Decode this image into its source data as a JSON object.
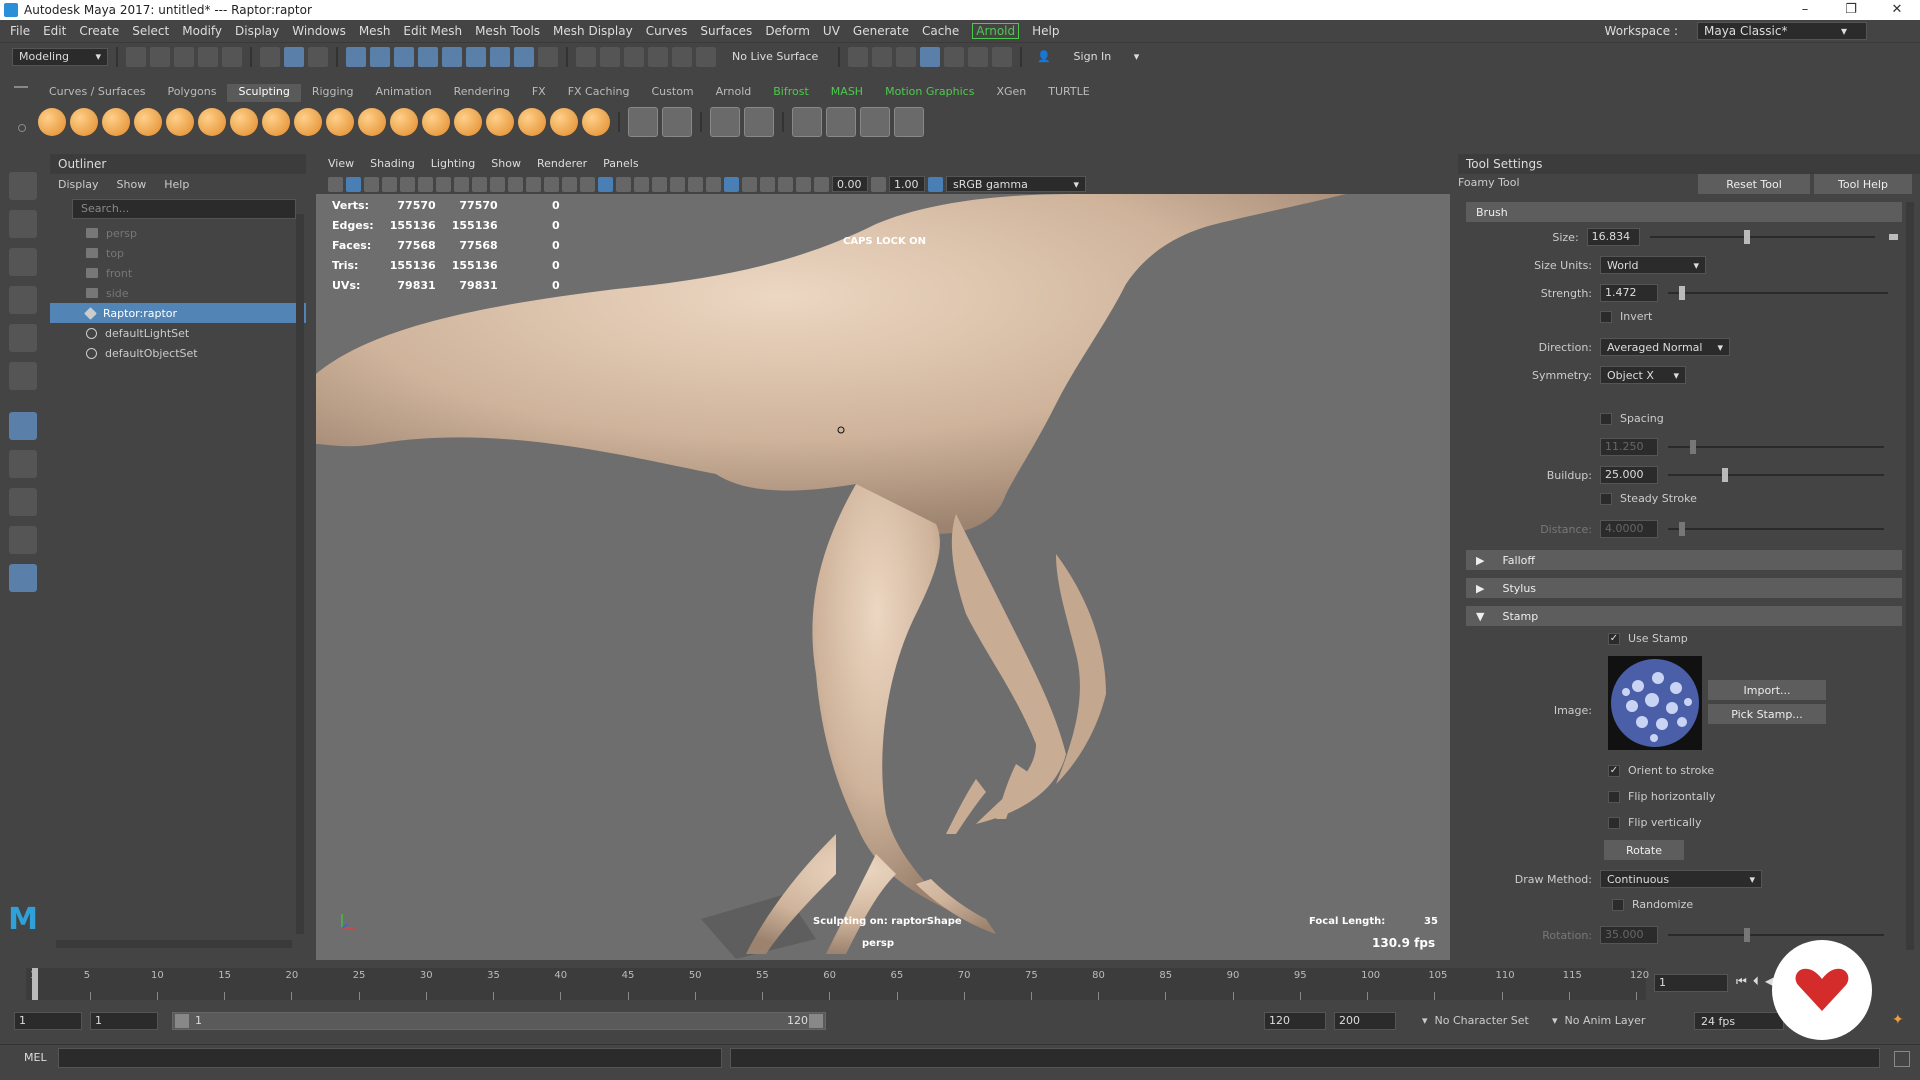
{
  "title": "Autodesk Maya 2017: untitled*   ---   Raptor:raptor",
  "window_controls": [
    "–",
    "❐",
    "✕"
  ],
  "menubar": [
    "File",
    "Edit",
    "Create",
    "Select",
    "Modify",
    "Display",
    "Windows",
    "Mesh",
    "Edit Mesh",
    "Mesh Tools",
    "Mesh Display",
    "Curves",
    "Surfaces",
    "Deform",
    "UV",
    "Generate",
    "Cache",
    "Arnold",
    "Help"
  ],
  "workspace": {
    "label": "Workspace :",
    "value": "Maya Classic*"
  },
  "statusline": {
    "mode": "Modeling",
    "live_surface": "No Live Surface",
    "sign_in": "Sign In"
  },
  "shelf_tabs": [
    "Curves / Surfaces",
    "Polygons",
    "Sculpting",
    "Rigging",
    "Animation",
    "Rendering",
    "FX",
    "FX Caching",
    "Custom",
    "Arnold",
    "Bifrost",
    "MASH",
    "Motion Graphics",
    "XGen",
    "TURTLE"
  ],
  "shelf_active": "Sculpting",
  "outliner": {
    "title": "Outliner",
    "menu": [
      "Display",
      "Show",
      "Help"
    ],
    "search_placeholder": "Search...",
    "items": [
      {
        "label": "persp",
        "icon": "camera-icon"
      },
      {
        "label": "top",
        "icon": "camera-icon"
      },
      {
        "label": "front",
        "icon": "camera-icon"
      },
      {
        "label": "side",
        "icon": "camera-icon"
      },
      {
        "label": "Raptor:raptor",
        "icon": "mesh-icon"
      },
      {
        "label": "defaultLightSet",
        "icon": "set-icon"
      },
      {
        "label": "defaultObjectSet",
        "icon": "set-icon"
      }
    ]
  },
  "viewport": {
    "menu": [
      "View",
      "Shading",
      "Lighting",
      "Show",
      "Renderer",
      "Panels"
    ],
    "exposure": "0.00",
    "gamma": "1.00",
    "color_space": "sRGB gamma",
    "stats": [
      {
        "label": "Verts:",
        "a": "77570",
        "b": "77570",
        "c": "0"
      },
      {
        "label": "Edges:",
        "a": "155136",
        "b": "155136",
        "c": "0"
      },
      {
        "label": "Faces:",
        "a": "77568",
        "b": "77568",
        "c": "0"
      },
      {
        "label": "Tris:",
        "a": "155136",
        "b": "155136",
        "c": "0"
      },
      {
        "label": "UVs:",
        "a": "79831",
        "b": "79831",
        "c": "0"
      }
    ],
    "caps_lock": "CAPS LOCK ON",
    "sculpting_on": "Sculpting on: raptorShape",
    "camera": "persp",
    "focal_label": "Focal Length:",
    "focal_value": "35",
    "fps": "130.9 fps"
  },
  "tool_settings": {
    "title": "Tool Settings",
    "tool_name": "Foamy Tool",
    "reset_btn": "Reset Tool",
    "help_btn": "Tool Help",
    "brush_section": "Brush",
    "size_label": "Size:",
    "size_value": "16.834",
    "size_fraction": 0.42,
    "size_units_label": "Size Units:",
    "size_units_value": "World",
    "strength_label": "Strength:",
    "strength_value": "1.472",
    "strength_fraction": 0.05,
    "invert_label": "Invert",
    "direction_label": "Direction:",
    "direction_value": "Averaged Normal",
    "symmetry_label": "Symmetry:",
    "symmetry_value": "Object X",
    "spacing_label": "Spacing",
    "spacing_value": "11.250",
    "spacing_fraction": 0.1,
    "buildup_label": "Buildup:",
    "buildup_value": "25.000",
    "buildup_fraction": 0.25,
    "steady_label": "Steady Stroke",
    "distance_label": "Distance:",
    "distance_value": "4.0000",
    "distance_fraction": 0.05,
    "falloff_section": "Falloff",
    "stylus_section": "Stylus",
    "stamp_section": "Stamp",
    "use_stamp_label": "Use Stamp",
    "image_label": "Image:",
    "import_btn": "Import...",
    "pick_btn": "Pick Stamp...",
    "orient_label": "Orient to stroke",
    "flip_h_label": "Flip horizontally",
    "flip_v_label": "Flip vertically",
    "rotate_btn": "Rotate",
    "draw_method_label": "Draw Method:",
    "draw_method_value": "Continuous",
    "randomize_label": "Randomize",
    "rotation_label": "Rotation:",
    "rotation_value": "35.000",
    "rotation_fraction": 0.35
  },
  "time_ticks": [
    "1",
    "5",
    "10",
    "15",
    "20",
    "25",
    "30",
    "35",
    "40",
    "45",
    "50",
    "55",
    "60",
    "65",
    "70",
    "75",
    "80",
    "85",
    "90",
    "95",
    "100",
    "105",
    "110",
    "115",
    "120"
  ],
  "current_frame": "1",
  "range": {
    "start": "1",
    "inner_start": "1",
    "slider_start": "1",
    "slider_end": "120",
    "end": "120",
    "anim_end": "200",
    "character_set": "No Character Set",
    "anim_layer": "No Anim Layer",
    "fps": "24 fps"
  },
  "cmd": {
    "lang": "MEL"
  }
}
